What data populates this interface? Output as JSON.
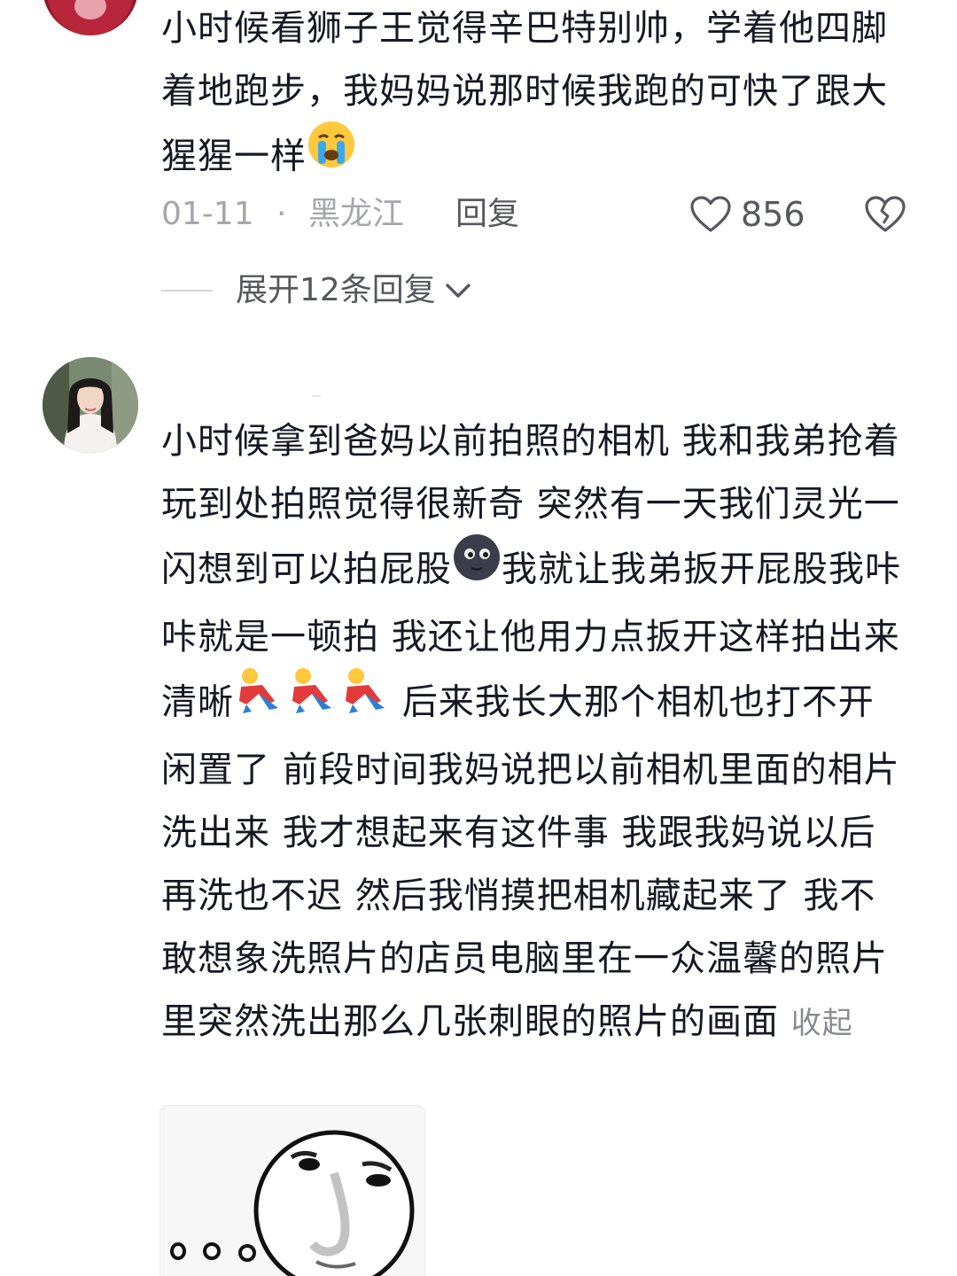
{
  "comments": [
    {
      "text_parts": [
        "小时候看狮子王觉得辛巴特别帅，学着他四脚着地跑步，我妈妈说那时候我跑的可快了跟大猩猩一样"
      ],
      "emoji": "crying-face-emoji",
      "date": "01-11",
      "separator": "·",
      "location": "黑龙江",
      "reply_label": "回复",
      "like_count": "856",
      "expand_label": "展开12条回复"
    },
    {
      "text_a": "小时候拿到爸妈以前拍照的相机 我和我弟抢着玩到处拍照觉得很新奇 突然有一天我们灵光一闪想到可以拍屁股",
      "emoji_a": "new-moon-face-emoji",
      "text_b": "我就让我弟扳开屁股我咔咔就是一顿拍 我还让他用力点扳开这样拍出来清晰",
      "emoji_b": "cartwheel-person-emoji",
      "text_c": " 后来我长大那个相机也打不开闲置了 前段时间我妈说把以前相机里面的相片洗出来 我才想起来有这件事 我跟我妈说以后再洗也不迟 然后我悄摸把相机藏起来了 我不敢想象洗照片的店员电脑里在一众温馨的照片里突然洗出那么几张刺眼的照片的画面",
      "collapse_label": "收起",
      "sticker": "round-face-sticker"
    }
  ],
  "colors": {
    "text": "#161823",
    "meta": "#a6a7ad",
    "secondary": "#57585e"
  }
}
